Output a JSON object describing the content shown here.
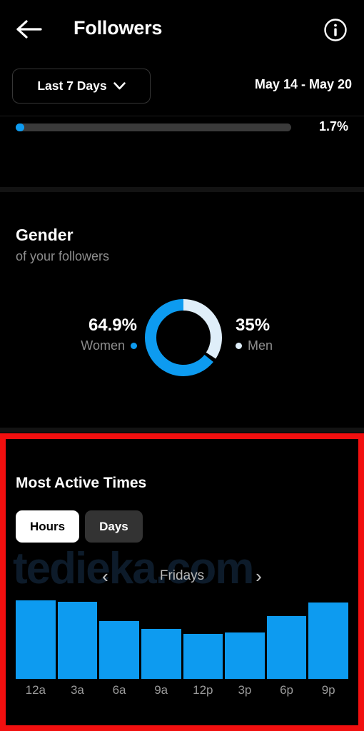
{
  "header": {
    "title": "Followers",
    "back_icon": "arrow-left-icon",
    "info_icon": "info-circle-icon"
  },
  "filter": {
    "range_label": "Last 7 Days",
    "chevron_icon": "chevron-down-icon",
    "date_range": "May 14 - May 20"
  },
  "progress": {
    "value_label": "1.7%",
    "fill_percent": 1.7,
    "fill_color": "#0d9bf0",
    "track_color": "#3a3a3a"
  },
  "gender": {
    "title": "Gender",
    "subtitle": "of your followers",
    "women_pct": "64.9%",
    "women_label": "Women",
    "women_color": "#0d9bf0",
    "men_pct": "35%",
    "men_label": "Men",
    "men_color": "#dfeef9"
  },
  "active_times": {
    "title": "Most Active Times",
    "toggles": [
      {
        "label": "Hours",
        "active": true
      },
      {
        "label": "Days",
        "active": false
      }
    ],
    "prev_icon": "chevron-left-icon",
    "next_icon": "chevron-right-icon",
    "day_label": "Fridays",
    "watermark": "tedieka.com",
    "highlight_color": "#f20f0f"
  },
  "chart_data": {
    "type": "bar",
    "title": "Most Active Times",
    "categories": [
      "12a",
      "3a",
      "6a",
      "9a",
      "12p",
      "3p",
      "6p",
      "9p"
    ],
    "values": [
      100,
      98,
      74,
      64,
      57,
      59,
      80,
      97
    ],
    "series": [
      {
        "name": "Fridays",
        "values": [
          100,
          98,
          74,
          64,
          57,
          59,
          80,
          97
        ]
      }
    ],
    "xlabel": "",
    "ylabel": "",
    "ylim": [
      0,
      100
    ],
    "grid": false,
    "legend": "none",
    "bar_color": "#0d9bf0"
  }
}
